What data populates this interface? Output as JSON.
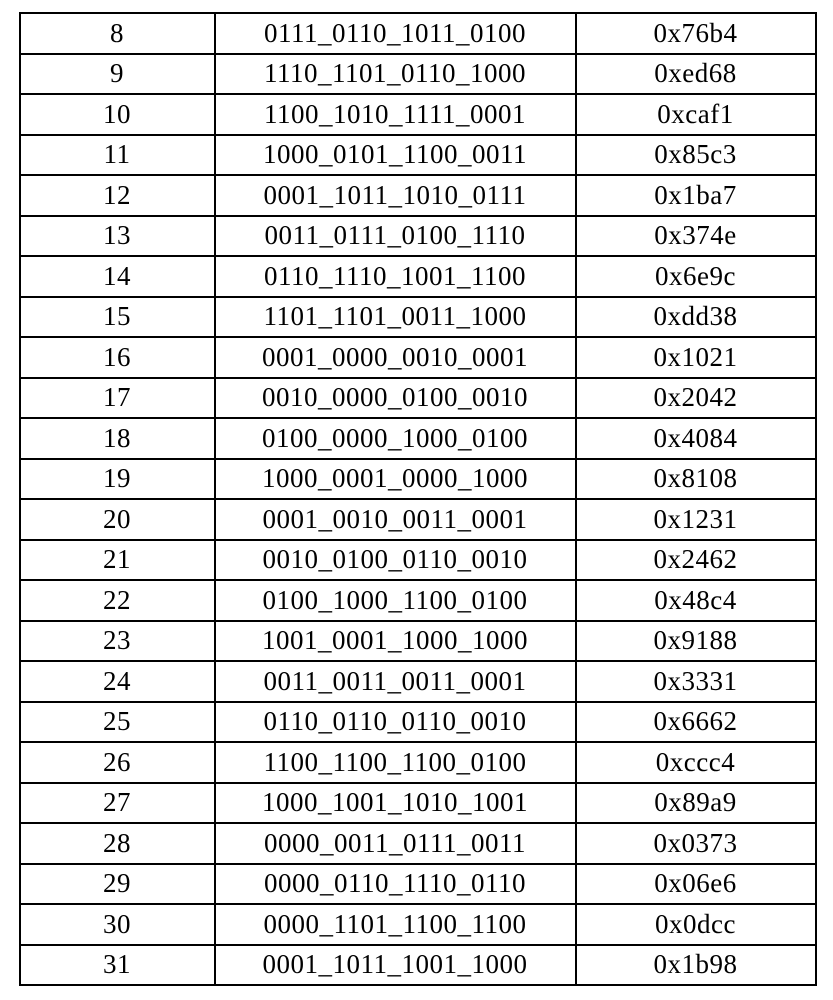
{
  "rows": [
    {
      "n": "8",
      "bin": "0111_0110_1011_0100",
      "hex": "0x76b4"
    },
    {
      "n": "9",
      "bin": "1110_1101_0110_1000",
      "hex": "0xed68"
    },
    {
      "n": "10",
      "bin": "1100_1010_1111_0001",
      "hex": "0xcaf1"
    },
    {
      "n": "11",
      "bin": "1000_0101_1100_0011",
      "hex": "0x85c3"
    },
    {
      "n": "12",
      "bin": "0001_1011_1010_0111",
      "hex": "0x1ba7"
    },
    {
      "n": "13",
      "bin": "0011_0111_0100_1110",
      "hex": "0x374e"
    },
    {
      "n": "14",
      "bin": "0110_1110_1001_1100",
      "hex": "0x6e9c"
    },
    {
      "n": "15",
      "bin": "1101_1101_0011_1000",
      "hex": "0xdd38"
    },
    {
      "n": "16",
      "bin": "0001_0000_0010_0001",
      "hex": "0x1021"
    },
    {
      "n": "17",
      "bin": "0010_0000_0100_0010",
      "hex": "0x2042"
    },
    {
      "n": "18",
      "bin": "0100_0000_1000_0100",
      "hex": "0x4084"
    },
    {
      "n": "19",
      "bin": "1000_0001_0000_1000",
      "hex": "0x8108"
    },
    {
      "n": "20",
      "bin": "0001_0010_0011_0001",
      "hex": "0x1231"
    },
    {
      "n": "21",
      "bin": "0010_0100_0110_0010",
      "hex": "0x2462"
    },
    {
      "n": "22",
      "bin": "0100_1000_1100_0100",
      "hex": "0x48c4"
    },
    {
      "n": "23",
      "bin": "1001_0001_1000_1000",
      "hex": "0x9188"
    },
    {
      "n": "24",
      "bin": "0011_0011_0011_0001",
      "hex": "0x3331"
    },
    {
      "n": "25",
      "bin": "0110_0110_0110_0010",
      "hex": "0x6662"
    },
    {
      "n": "26",
      "bin": "1100_1100_1100_0100",
      "hex": "0xccc4"
    },
    {
      "n": "27",
      "bin": "1000_1001_1010_1001",
      "hex": "0x89a9"
    },
    {
      "n": "28",
      "bin": "0000_0011_0111_0011",
      "hex": "0x0373"
    },
    {
      "n": "29",
      "bin": "0000_0110_1110_0110",
      "hex": "0x06e6"
    },
    {
      "n": "30",
      "bin": "0000_1101_1100_1100",
      "hex": "0x0dcc"
    },
    {
      "n": "31",
      "bin": "0001_1011_1001_1000",
      "hex": "0x1b98"
    }
  ]
}
